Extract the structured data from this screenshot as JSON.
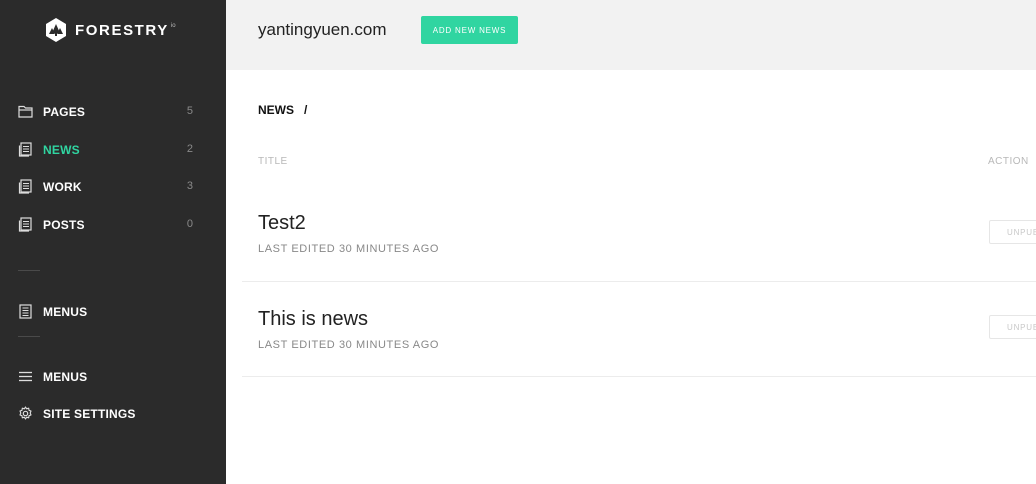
{
  "brand": {
    "name": "FORESTRY",
    "suffix": "io"
  },
  "sidebar": {
    "items": [
      {
        "label": "PAGES",
        "count": "5",
        "icon": "folder-icon"
      },
      {
        "label": "NEWS",
        "count": "2",
        "icon": "document-icon"
      },
      {
        "label": "WORK",
        "count": "3",
        "icon": "document-icon"
      },
      {
        "label": "POSTS",
        "count": "0",
        "icon": "document-icon"
      }
    ],
    "menus_item": {
      "label": "MENUS",
      "icon": "list-document-icon"
    },
    "bottom": [
      {
        "label": "MENUS",
        "icon": "hamburger-icon"
      },
      {
        "label": "SITE SETTINGS",
        "icon": "gear-icon"
      }
    ]
  },
  "header": {
    "site_name": "yantingyuen.com",
    "add_button": "ADD NEW NEWS"
  },
  "breadcrumb": {
    "section": "NEWS",
    "separator": "/"
  },
  "table": {
    "col_title": "TITLE",
    "col_action": "ACTION",
    "rows": [
      {
        "title": "Test2",
        "subtitle": "LAST EDITED 30 MINUTES AGO",
        "action": "UNPUBLISH"
      },
      {
        "title": "This is news",
        "subtitle": "LAST EDITED 30 MINUTES AGO",
        "action": "UNPUBLISH"
      }
    ]
  },
  "colors": {
    "accent": "#30d5a1",
    "sidebar_bg": "#2b2b2b",
    "topbar_bg": "#f2f2f2"
  }
}
